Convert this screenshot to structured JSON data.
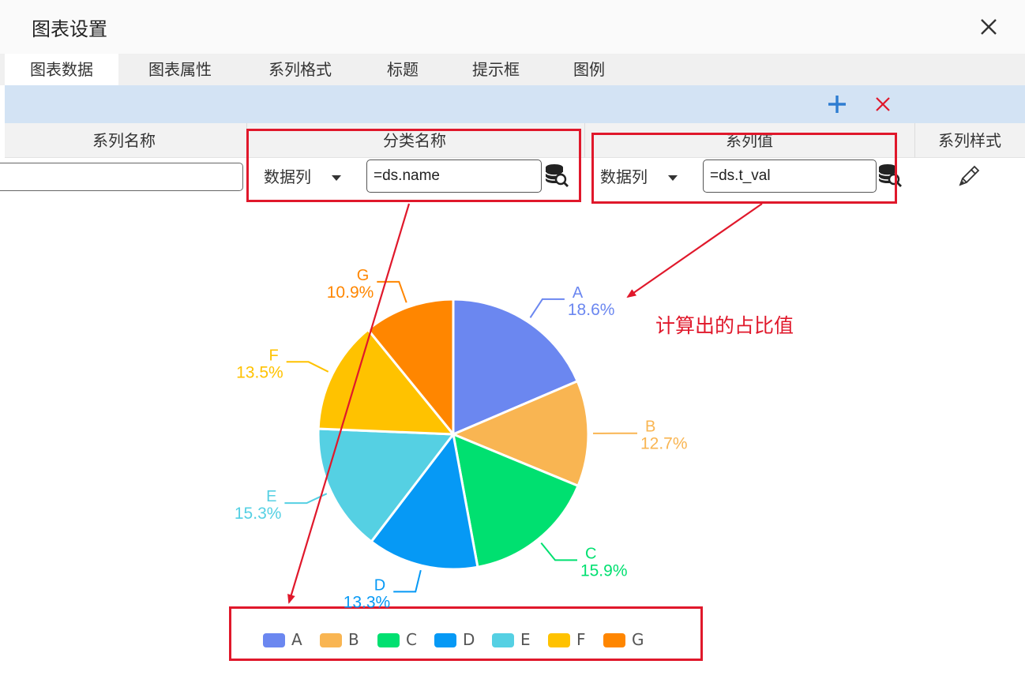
{
  "dialog": {
    "title": "图表设置",
    "close_icon": "close-icon"
  },
  "tabs": [
    {
      "label": "图表数据",
      "active": true
    },
    {
      "label": "图表属性"
    },
    {
      "label": "系列格式"
    },
    {
      "label": "标题"
    },
    {
      "label": "提示框"
    },
    {
      "label": "图例"
    }
  ],
  "toolbar": {
    "add_icon": "plus-icon",
    "delete_icon": "close-icon",
    "add_color": "#2e7dd1",
    "delete_color": "#e0182b"
  },
  "columns": {
    "series_name": "系列名称",
    "category_name": "分类名称",
    "series_value": "系列值",
    "series_style": "系列样式"
  },
  "row": {
    "series_name_value": "",
    "category_type": "数据列",
    "category_formula": "=ds.name",
    "value_type": "数据列",
    "value_formula": "=ds.t_val",
    "datasource_icon": "database-search-icon",
    "style_icon": "brush-icon"
  },
  "annotation": {
    "text": "计算出的占比值",
    "color": "#e0182b"
  },
  "chart_data": {
    "type": "pie",
    "title": "",
    "categories": [
      "A",
      "B",
      "C",
      "D",
      "E",
      "F",
      "G"
    ],
    "values": [
      18.6,
      12.7,
      15.9,
      13.3,
      15.3,
      13.5,
      10.9
    ],
    "labels": [
      "18.6%",
      "12.7%",
      "15.9%",
      "13.3%",
      "15.3%",
      "13.5%",
      "10.9%"
    ],
    "colors": [
      "#6b87f0",
      "#f9b552",
      "#00e070",
      "#0699f5",
      "#55d0e3",
      "#ffc200",
      "#ff8600"
    ],
    "legend": "bottom",
    "start_angle_deg": 90,
    "direction": "clockwise"
  }
}
